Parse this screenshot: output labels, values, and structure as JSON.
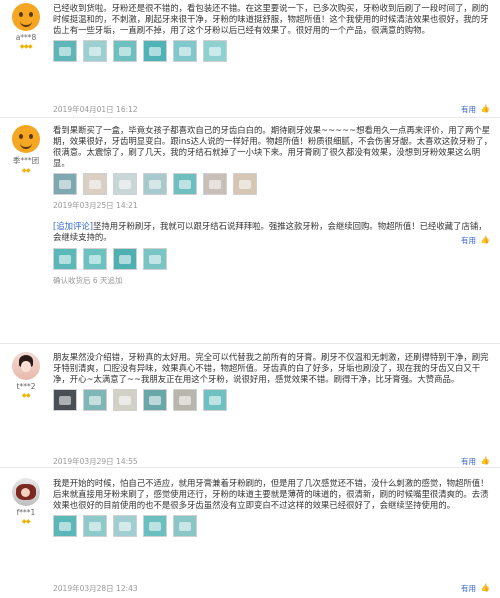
{
  "useful_label": "有用",
  "useful_icon": "thumbs-up-icon",
  "reviews": [
    {
      "user": {
        "name": "a***8",
        "avatar": "orange-emoji-avatar"
      },
      "text": "已经收到货啦。牙粉还是很不错的，看包装还不错。在这里要说一下，已多次购买，牙粉收到后刷了一段时间了，刷的时候挺温和的，不刺激，刷起牙来很干净，牙粉的味道挺舒服，物超所值！这个我使用的时候清洁效果也很好，我的牙齿上有一些牙垢，一直刷不掉，用了这个牙粉以后已经有效果了。很好用的一个产品，很满意的购物。",
      "date": "2019年04月01日 16:12",
      "thumb_colors": [
        "#5fb6b9",
        "#9ccfd2",
        "#6dbfc0",
        "#4fb3b8",
        "#80c8cc",
        "#8fd0d0"
      ]
    },
    {
      "user": {
        "name": "季***团",
        "avatar": "orange-emoji-avatar"
      },
      "text": "看到果断买了一盒，毕竟女孩子都喜欢自己的牙齿白白的。期待刷牙效果~~~~~想看用久一点再来评价，用了两个星期，效果很好，牙齿明显变白。跟ins达人说的一样好用。物超所值！粉质很细腻，不会伤害牙龈。太喜欢这款牙粉了，很满意。太震惊了，刷了几天，我的牙结石就掉了一小块下来。用牙膏刷了很久都没有效果，没想到牙粉效果这么明显。",
      "date": "2019年03月25日 14:21",
      "thumb_colors": [
        "#7fa9b0",
        "#d9cfc3",
        "#c9d6d8",
        "#a6c9cc",
        "#6fbfc1",
        "#c8c0b8",
        "#d6c7b5"
      ],
      "append": {
        "label": "[追加评论]",
        "text": "坚持用牙粉刷牙，我就可以跟牙结石说拜拜啦。强推这款牙粉，会继续回购。物超所值！已经收藏了店铺，会继续支持的。",
        "thumb_colors": [
          "#5bb8b8",
          "#6cc2c0",
          "#4fb0b2",
          "#78c5c4"
        ],
        "meta": "确认收货后 6 天追加"
      }
    },
    {
      "user": {
        "name": "t***2",
        "avatar": "girl-photo-avatar"
      },
      "text": "朋友果然没介绍错，牙粉真的太好用。完全可以代替我之前所有的牙膏。刷牙不仅温和无刺激，还刷得特别干净，刷完牙特别清爽，口腔没有异味，效果真心不错，物超所值。牙齿真的白了好多，牙垢也刷没了，现在我的牙齿又白又干净，开心~太满意了~~我朋友正在用这个牙粉，说很好用，感觉效果不错。刷得干净，比牙膏强。大赞商品。",
      "date": "2019年03月29日 14:55",
      "thumb_colors": [
        "#4a4f55",
        "#7fb7b9",
        "#d3d0c8",
        "#6aa7a9",
        "#b8b5ad",
        "#6fc0c0"
      ]
    },
    {
      "user": {
        "name": "f***1",
        "avatar": "profile-photo-avatar"
      },
      "text": "我是开始的时候，怕自己不适应，就用牙膏兼着牙粉刷的，但是用了几次感觉还不错，没什么刺激的感觉，物超所值！后来就直接用牙粉来刷了，感觉使用还行，牙粉的味道主要就是薄荷的味道的，很清新，刷的时候嘴里很清爽的。去渍效果也很好的目前使用的也不是很多牙齿虽然没有立即变白不过这样的效果已经很好了，会继续坚持使用的。",
      "date": "2019年03月28日 12:43",
      "thumb_colors": [
        "#5cb7b8",
        "#8fcacb",
        "#a1cfd1",
        "#6cbfc0",
        "#8bc6c7"
      ]
    }
  ]
}
